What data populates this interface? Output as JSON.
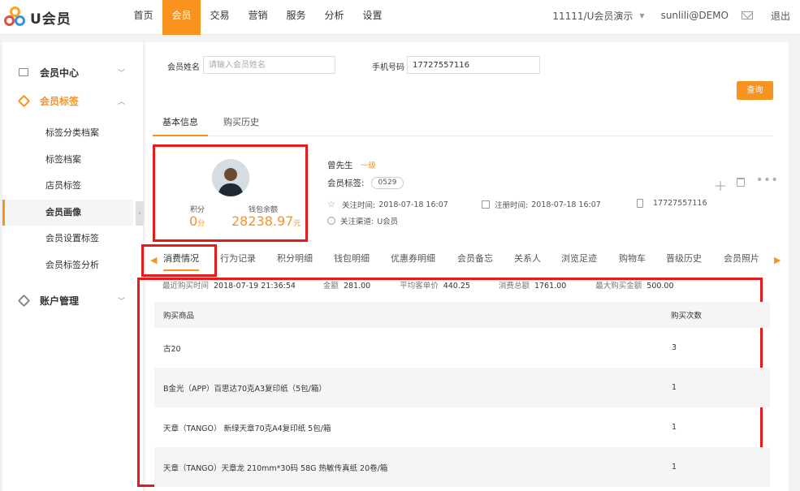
{
  "app": {
    "logo_text": "U会员"
  },
  "nav": [
    "首页",
    "会员",
    "交易",
    "营销",
    "服务",
    "分析",
    "设置"
  ],
  "top_right": {
    "store": "11111/U会员演示",
    "user": "sunlili@DEMO",
    "logout": "退出"
  },
  "sidebar": {
    "groups": [
      {
        "label": "会员中心",
        "icon": "member-center-icon"
      },
      {
        "label": "会员标签",
        "icon": "tag-icon"
      },
      {
        "label": "账户管理",
        "icon": "tag-icon"
      }
    ],
    "items": [
      "标签分类档案",
      "标签档案",
      "店员标签",
      "会员画像",
      "会员设置标签",
      "会员标签分析"
    ]
  },
  "search": {
    "name_label": "会员姓名",
    "name_placeholder": "请输入会员姓名",
    "phone_label": "手机号码",
    "phone_value": "17727557116",
    "query_label": "查询"
  },
  "tabs_top": [
    "基本信息",
    "购买历史"
  ],
  "profile": {
    "points_label": "积分",
    "points_value": "0",
    "points_unit": "分",
    "wallet_label": "钱包余额",
    "wallet_value": "28238.97",
    "wallet_unit": "元",
    "name": "曾先生",
    "level": "一级",
    "tag_label": "会员标签:",
    "tag_value": "0529",
    "follow_time_label": "关注时间:",
    "follow_time": "2018-07-18 16:07",
    "register_time_label": "注册时间:",
    "register_time": "2018-07-18 16:07",
    "phone": "17727557116",
    "channel_label": "关注渠道:",
    "channel": "U会员"
  },
  "tabs_detail": [
    "消费情况",
    "行为记录",
    "积分明细",
    "钱包明细",
    "优惠券明细",
    "会员备忘",
    "关系人",
    "浏览足迹",
    "购物车",
    "晋级历史",
    "会员照片"
  ],
  "stats": [
    {
      "label": "最近购买时间",
      "value": "2018-07-19 21:36:54"
    },
    {
      "label": "金额",
      "value": "281.00"
    },
    {
      "label": "平均客单价",
      "value": "440.25"
    },
    {
      "label": "消费总额",
      "value": "1761.00"
    },
    {
      "label": "最大购买金额",
      "value": "500.00"
    }
  ],
  "table": {
    "headers": [
      "购买商品",
      "购买次数"
    ],
    "rows": [
      {
        "product": "古20",
        "count": "3"
      },
      {
        "product": "B金光（APP）百思达70克A3复印纸（5包/箱）",
        "count": "1"
      },
      {
        "product": "天章（TANGO） 新绿天章70克A4复印纸 5包/箱",
        "count": "1"
      },
      {
        "product": "天章（TANGO）天章龙 210mm*30码 58G 热敏传真纸 20卷/箱",
        "count": "1"
      }
    ]
  },
  "colors": {
    "accent": "#f7931e",
    "highlight_box": "#e31b1b"
  }
}
